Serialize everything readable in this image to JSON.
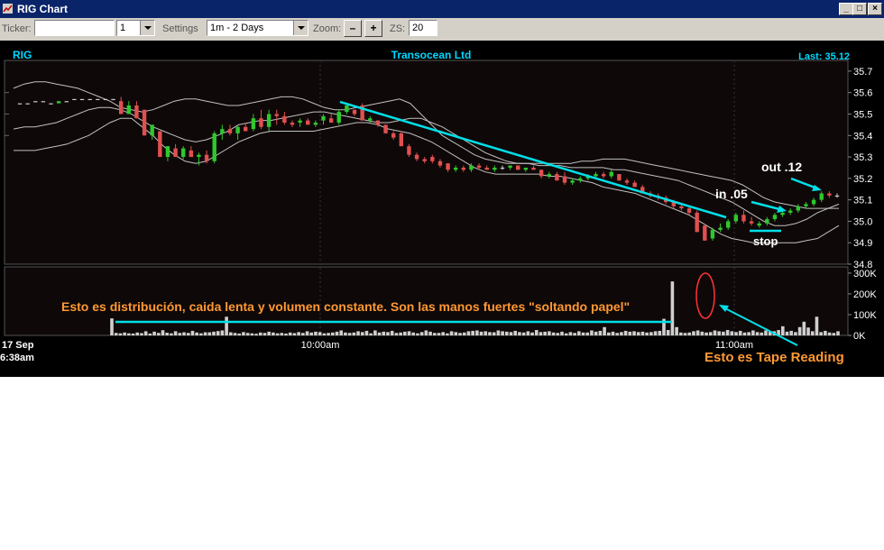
{
  "window": {
    "title": "RIG Chart",
    "min_label": "_",
    "max_label": "□",
    "close_label": "×"
  },
  "toolbar": {
    "ticker_label": "Ticker:",
    "ticker_value": "",
    "interval_value": "1",
    "settings_label": "Settings",
    "range_value": "1m - 2 Days",
    "zoom_label": "Zoom:",
    "zoom_out": "–",
    "zoom_in": "+",
    "zs_label": "ZS:",
    "zs_value": "20"
  },
  "chart_data": {
    "type": "candlestick",
    "symbol": "RIG",
    "title": "Transocean Ltd",
    "last_label": "Last: 35.12",
    "price_ylim": [
      34.8,
      35.75
    ],
    "price_ticks": [
      34.8,
      34.9,
      35.0,
      35.1,
      35.2,
      35.3,
      35.4,
      35.5,
      35.6,
      35.7
    ],
    "volume_ylim": [
      0,
      330000
    ],
    "volume_ticks": [
      "0K",
      "100K",
      "200K",
      "300K"
    ],
    "x_ticks": [
      "17 Sep",
      "10:00am",
      "11:00am"
    ],
    "x_first_time": "6:38am",
    "colors": {
      "up": "#2ec82e",
      "down": "#e05050",
      "flat": "#cccccc",
      "annotation": "#00ffff",
      "text_orange": "#ff9933",
      "bands": "#c0c0c0"
    },
    "candles": [
      [
        35.55,
        35.55,
        35.55,
        35.55
      ],
      [
        35.55,
        35.55,
        35.55,
        35.55
      ],
      [
        35.56,
        35.56,
        35.56,
        35.56
      ],
      [
        35.56,
        35.56,
        35.56,
        35.56
      ],
      [
        35.55,
        35.55,
        35.55,
        35.55
      ],
      [
        35.55,
        35.56,
        35.55,
        35.56
      ],
      [
        35.56,
        35.56,
        35.56,
        35.56
      ],
      [
        35.57,
        35.57,
        35.57,
        35.57
      ],
      [
        35.57,
        35.57,
        35.57,
        35.57
      ],
      [
        35.57,
        35.57,
        35.57,
        35.57
      ],
      [
        35.57,
        35.57,
        35.57,
        35.57
      ],
      [
        35.57,
        35.57,
        35.57,
        35.57
      ],
      [
        35.57,
        35.57,
        35.57,
        35.57
      ],
      [
        35.56,
        35.58,
        35.5,
        35.5
      ],
      [
        35.5,
        35.56,
        35.5,
        35.54
      ],
      [
        35.54,
        35.56,
        35.48,
        35.48
      ],
      [
        35.52,
        35.52,
        35.4,
        35.4
      ],
      [
        35.4,
        35.45,
        35.38,
        35.45
      ],
      [
        35.42,
        35.42,
        35.3,
        35.3
      ],
      [
        35.3,
        35.35,
        35.28,
        35.35
      ],
      [
        35.34,
        35.36,
        35.3,
        35.3
      ],
      [
        35.3,
        35.35,
        35.29,
        35.34
      ],
      [
        35.33,
        35.35,
        35.3,
        35.3
      ],
      [
        35.3,
        35.32,
        35.26,
        35.31
      ],
      [
        35.31,
        35.33,
        35.27,
        35.28
      ],
      [
        35.28,
        35.42,
        35.27,
        35.41
      ],
      [
        35.41,
        35.45,
        35.38,
        35.43
      ],
      [
        35.43,
        35.45,
        35.4,
        35.41
      ],
      [
        35.41,
        35.45,
        35.38,
        35.44
      ],
      [
        35.44,
        35.46,
        35.42,
        35.42
      ],
      [
        35.43,
        35.5,
        35.42,
        35.48
      ],
      [
        35.48,
        35.52,
        35.43,
        35.44
      ],
      [
        35.44,
        35.52,
        35.42,
        35.5
      ],
      [
        35.5,
        35.52,
        35.45,
        35.49
      ],
      [
        35.49,
        35.51,
        35.45,
        35.46
      ],
      [
        35.46,
        35.47,
        35.44,
        35.45
      ],
      [
        35.46,
        35.48,
        35.44,
        35.47
      ],
      [
        35.47,
        35.48,
        35.45,
        35.45
      ],
      [
        35.45,
        35.47,
        35.44,
        35.46
      ],
      [
        35.47,
        35.5,
        35.45,
        35.49
      ],
      [
        35.48,
        35.5,
        35.46,
        35.46
      ],
      [
        35.46,
        35.52,
        35.45,
        35.51
      ],
      [
        35.51,
        35.55,
        35.5,
        35.54
      ],
      [
        35.52,
        35.52,
        35.49,
        35.5
      ],
      [
        35.54,
        35.55,
        35.47,
        35.47
      ],
      [
        35.47,
        35.49,
        35.46,
        35.48
      ],
      [
        35.47,
        35.47,
        35.44,
        35.45
      ],
      [
        35.45,
        35.45,
        35.41,
        35.41
      ],
      [
        35.41,
        35.42,
        35.38,
        35.39
      ],
      [
        35.41,
        35.42,
        35.35,
        35.35
      ],
      [
        35.35,
        35.36,
        35.3,
        35.31
      ],
      [
        35.31,
        35.32,
        35.28,
        35.29
      ],
      [
        35.29,
        35.3,
        35.27,
        35.28
      ],
      [
        35.3,
        35.31,
        35.27,
        35.28
      ],
      [
        35.28,
        35.29,
        35.25,
        35.26
      ],
      [
        35.27,
        35.27,
        35.23,
        35.24
      ],
      [
        35.24,
        35.26,
        35.23,
        35.25
      ],
      [
        35.25,
        35.26,
        35.23,
        35.24
      ],
      [
        35.24,
        35.27,
        35.23,
        35.26
      ],
      [
        35.26,
        35.27,
        35.24,
        35.25
      ],
      [
        35.25,
        35.26,
        35.24,
        35.24
      ],
      [
        35.24,
        35.26,
        35.23,
        35.25
      ],
      [
        35.25,
        35.26,
        35.24,
        35.25
      ],
      [
        35.25,
        35.26,
        35.24,
        35.26
      ],
      [
        35.26,
        35.26,
        35.24,
        35.24
      ],
      [
        35.24,
        35.25,
        35.23,
        35.25
      ],
      [
        35.25,
        35.26,
        35.24,
        35.24
      ],
      [
        35.24,
        35.24,
        35.2,
        35.21
      ],
      [
        35.21,
        35.23,
        35.2,
        35.22
      ],
      [
        35.22,
        35.23,
        35.19,
        35.19
      ],
      [
        35.21,
        35.23,
        35.17,
        35.18
      ],
      [
        35.18,
        35.2,
        35.17,
        35.19
      ],
      [
        35.19,
        35.21,
        35.18,
        35.2
      ],
      [
        35.2,
        35.22,
        35.19,
        35.21
      ],
      [
        35.21,
        35.23,
        35.2,
        35.22
      ],
      [
        35.22,
        35.23,
        35.2,
        35.21
      ],
      [
        35.21,
        35.24,
        35.2,
        35.23
      ],
      [
        35.22,
        35.22,
        35.19,
        35.19
      ],
      [
        35.19,
        35.2,
        35.17,
        35.18
      ],
      [
        35.18,
        35.19,
        35.16,
        35.16
      ],
      [
        35.16,
        35.17,
        35.13,
        35.13
      ],
      [
        35.13,
        35.14,
        35.11,
        35.12
      ],
      [
        35.12,
        35.13,
        35.1,
        35.11
      ],
      [
        35.11,
        35.12,
        35.08,
        35.09
      ],
      [
        35.09,
        35.1,
        35.06,
        35.07
      ],
      [
        35.07,
        35.08,
        35.05,
        35.06
      ],
      [
        35.06,
        35.07,
        35.03,
        35.04
      ],
      [
        35.04,
        35.05,
        34.95,
        34.95
      ],
      [
        34.98,
        34.98,
        34.91,
        34.91
      ],
      [
        34.92,
        34.97,
        34.91,
        34.96
      ],
      [
        34.96,
        34.99,
        34.95,
        34.97
      ],
      [
        34.97,
        35.01,
        34.96,
        35.0
      ],
      [
        35.0,
        35.04,
        34.99,
        35.03
      ],
      [
        35.03,
        35.05,
        34.99,
        35.0
      ],
      [
        35.0,
        35.02,
        34.98,
        34.99
      ],
      [
        34.98,
        35.0,
        34.97,
        34.99
      ],
      [
        34.99,
        35.02,
        34.98,
        35.01
      ],
      [
        35.01,
        35.04,
        35.0,
        35.03
      ],
      [
        35.03,
        35.05,
        35.02,
        35.04
      ],
      [
        35.04,
        35.06,
        35.03,
        35.05
      ],
      [
        35.05,
        35.08,
        35.04,
        35.07
      ],
      [
        35.07,
        35.09,
        35.06,
        35.08
      ],
      [
        35.08,
        35.11,
        35.07,
        35.1
      ],
      [
        35.1,
        35.14,
        35.09,
        35.13
      ],
      [
        35.13,
        35.14,
        35.11,
        35.12
      ],
      [
        35.12,
        35.13,
        35.11,
        35.12
      ]
    ],
    "upper_band": [
      35.62,
      35.64,
      35.65,
      35.65,
      35.64,
      35.63,
      35.62,
      35.6,
      35.58,
      35.56,
      35.53,
      35.52,
      35.51,
      35.52,
      35.54,
      35.56,
      35.57,
      35.57,
      35.56,
      35.55,
      35.54,
      35.54,
      35.55,
      35.56,
      35.57,
      35.58,
      35.58,
      35.57,
      35.55,
      35.53,
      35.52,
      35.52,
      35.53,
      35.54,
      35.55,
      35.56,
      35.57,
      35.55,
      35.5,
      35.45,
      35.4,
      35.37,
      35.34,
      35.31,
      35.29,
      35.28,
      35.27,
      35.27,
      35.27,
      35.27,
      35.27,
      35.27,
      35.27,
      35.28,
      35.28,
      35.29,
      35.29,
      35.29,
      35.28,
      35.27,
      35.26,
      35.25,
      35.24,
      35.23,
      35.22,
      35.21,
      35.2,
      35.19,
      35.17,
      35.14,
      35.11,
      35.09,
      35.08,
      35.07,
      35.06,
      35.06,
      35.06,
      35.06
    ],
    "middle_band": [
      35.43,
      35.44,
      35.44,
      35.45,
      35.46,
      35.48,
      35.5,
      35.52,
      35.53,
      35.53,
      35.52,
      35.5,
      35.47,
      35.44,
      35.42,
      35.4,
      35.38,
      35.37,
      35.38,
      35.4,
      35.42,
      35.45,
      35.46,
      35.47,
      35.47,
      35.48,
      35.49,
      35.5,
      35.51,
      35.51,
      35.5,
      35.49,
      35.48,
      35.47,
      35.46,
      35.46,
      35.47,
      35.48,
      35.48,
      35.46,
      35.44,
      35.41,
      35.38,
      35.35,
      35.32,
      35.3,
      35.28,
      35.27,
      35.27,
      35.26,
      35.26,
      35.26,
      35.25,
      35.25,
      35.25,
      35.25,
      35.24,
      35.24,
      35.23,
      35.22,
      35.21,
      35.2,
      35.19,
      35.17,
      35.15,
      35.13,
      35.11,
      35.09,
      35.06,
      35.03,
      35.0,
      34.98,
      34.98,
      34.99,
      35.01,
      35.04,
      35.06,
      35.08
    ],
    "lower_band": [
      35.33,
      35.33,
      35.33,
      35.34,
      35.35,
      35.36,
      35.38,
      35.4,
      35.43,
      35.46,
      35.48,
      35.48,
      35.44,
      35.4,
      35.35,
      35.31,
      35.28,
      35.27,
      35.28,
      35.31,
      35.34,
      35.37,
      35.39,
      35.41,
      35.42,
      35.42,
      35.42,
      35.42,
      35.42,
      35.43,
      35.44,
      35.45,
      35.46,
      35.46,
      35.45,
      35.43,
      35.42,
      35.41,
      35.39,
      35.37,
      35.34,
      35.31,
      35.28,
      35.25,
      35.23,
      35.22,
      35.22,
      35.22,
      35.22,
      35.22,
      35.21,
      35.21,
      35.2,
      35.19,
      35.18,
      35.16,
      35.15,
      35.14,
      35.13,
      35.11,
      35.09,
      35.07,
      35.05,
      35.03,
      35.0,
      34.97,
      34.94,
      34.92,
      34.91,
      34.9,
      34.9,
      34.9,
      34.9,
      34.9,
      34.91,
      34.92,
      34.95,
      34.98
    ],
    "volume": [
      82,
      12,
      10,
      14,
      10,
      9,
      14,
      11,
      20,
      9,
      18,
      12,
      25,
      13,
      10,
      20,
      12,
      15,
      12,
      22,
      14,
      10,
      15,
      15,
      18,
      21,
      24,
      90,
      15,
      12,
      9,
      16,
      12,
      10,
      8,
      14,
      12,
      18,
      14,
      10,
      12,
      9,
      14,
      11,
      16,
      12,
      20,
      14,
      18,
      16,
      10,
      12,
      14,
      18,
      24,
      14,
      12,
      14,
      20,
      16,
      22,
      10,
      24,
      14,
      18,
      16,
      22,
      12,
      14,
      18,
      20,
      14,
      10,
      16,
      24,
      18,
      12,
      12,
      16,
      10,
      20,
      16,
      12,
      14,
      20,
      22,
      24,
      18,
      20,
      16,
      15,
      24,
      20,
      18,
      16,
      22,
      16,
      14,
      20,
      14,
      26,
      16,
      18,
      20,
      14,
      12,
      18,
      10,
      16,
      12,
      20,
      14,
      14,
      24,
      18,
      22,
      40,
      14,
      18,
      12,
      16,
      22,
      18,
      20,
      16,
      18,
      14,
      16,
      20,
      22,
      80,
      26,
      260,
      40,
      14,
      12,
      14,
      20,
      24,
      18,
      14,
      16,
      24,
      20,
      18,
      26,
      20,
      16,
      22,
      14,
      16,
      24,
      16,
      14,
      24,
      18,
      20,
      26,
      44,
      18,
      22,
      16,
      40,
      66,
      38,
      20,
      90,
      16,
      22,
      14,
      12,
      20
    ],
    "annotations": {
      "in_label": "in .05",
      "out_label": "out .12",
      "stop_label": "stop",
      "distribution_text": "Esto es distribución, caida lenta y volumen constante. Son las manos fuertes \"soltando papel\"",
      "tape_text": "Esto es Tape Reading"
    }
  }
}
